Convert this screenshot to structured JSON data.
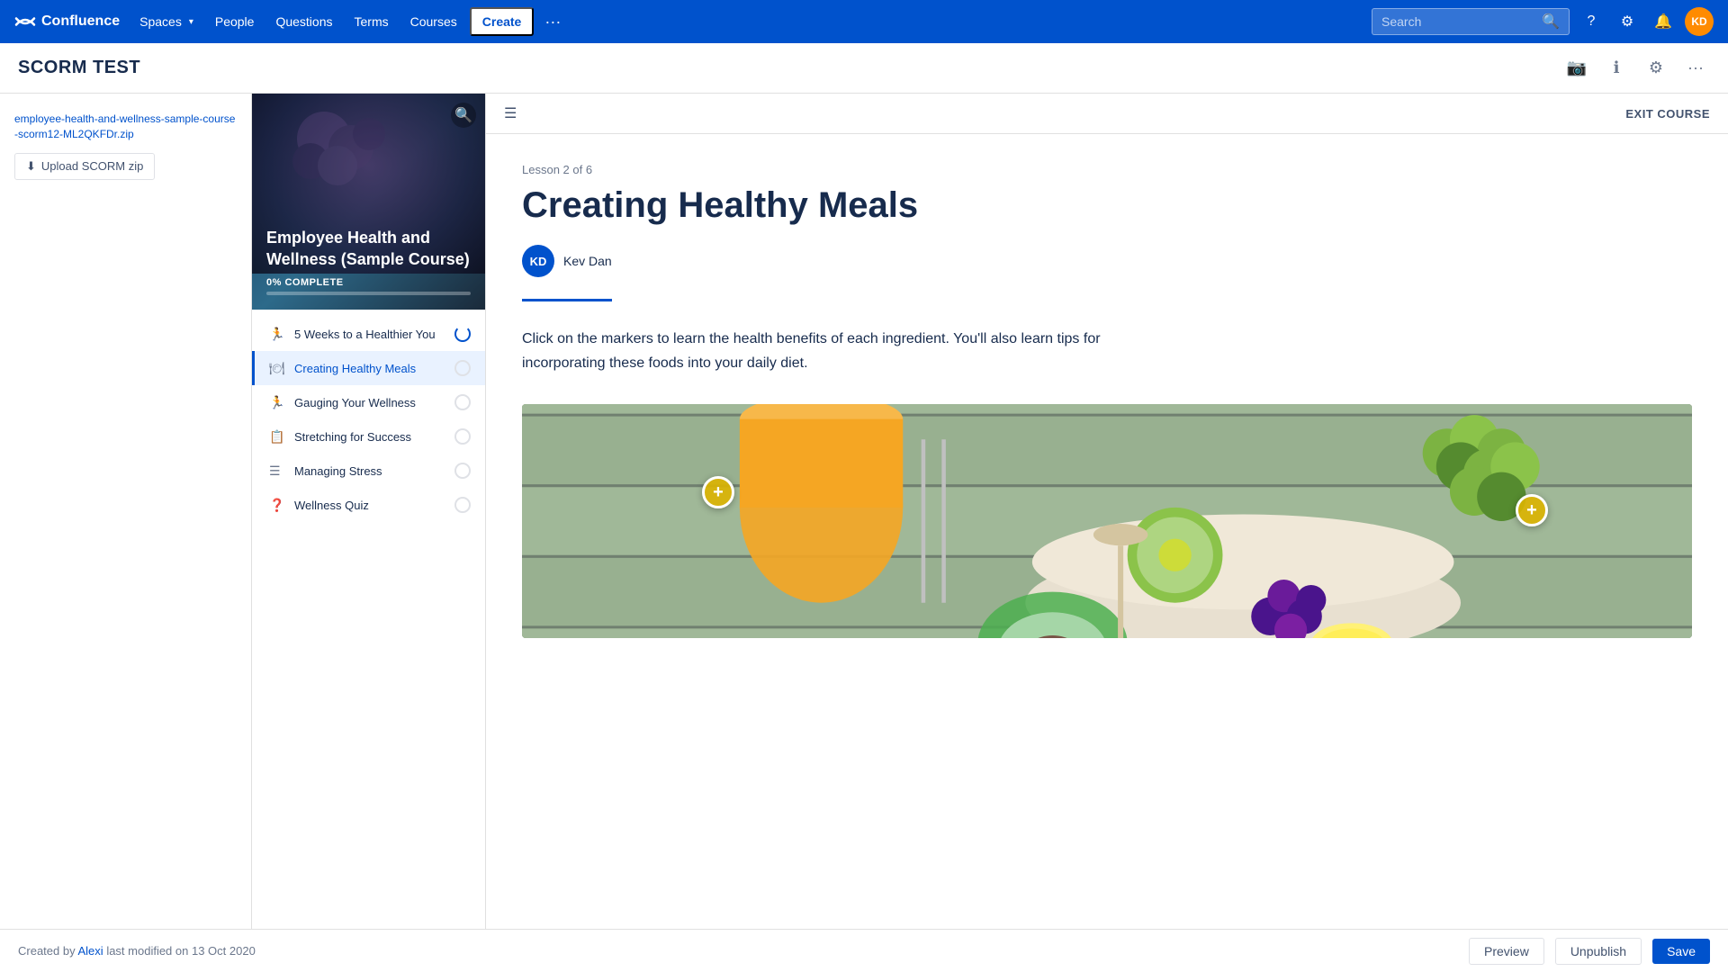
{
  "nav": {
    "logo_text": "Confluence",
    "spaces_label": "Spaces",
    "people_label": "People",
    "questions_label": "Questions",
    "terms_label": "Terms",
    "courses_label": "Courses",
    "create_label": "Create",
    "search_placeholder": "Search",
    "more_icon": "···"
  },
  "page_header": {
    "title": "SCORM TEST"
  },
  "sidebar": {
    "file_name": "employee-health-and-wellness-sample-course-scorm12-ML2QKFDr.zip",
    "upload_label": "Upload SCORM zip"
  },
  "course": {
    "hero_title": "Employee Health and Wellness (Sample Course)",
    "progress_label": "0% COMPLETE",
    "progress_pct": 0
  },
  "course_menu": {
    "items": [
      {
        "id": "item-1",
        "icon": "🏃",
        "label": "5 Weeks to a Healthier You",
        "status": "loading",
        "active": false
      },
      {
        "id": "item-2",
        "icon": "🍽",
        "label": "Creating Healthy Meals",
        "status": "empty",
        "active": true
      },
      {
        "id": "item-3",
        "icon": "🏃",
        "label": "Gauging Your Wellness",
        "status": "empty",
        "active": false
      },
      {
        "id": "item-4",
        "icon": "📋",
        "label": "Stretching for Success",
        "status": "empty",
        "active": false
      },
      {
        "id": "item-5",
        "icon": "☰",
        "label": "Managing Stress",
        "status": "empty",
        "active": false
      },
      {
        "id": "item-6",
        "icon": "❓",
        "label": "Wellness Quiz",
        "status": "empty",
        "active": false
      }
    ]
  },
  "lesson": {
    "label": "Lesson 2 of 6",
    "title": "Creating Healthy Meals",
    "author_initials": "KD",
    "author_name": "Kev Dan",
    "description": "Click on the markers to learn the health benefits of each ingredient. You'll also learn tips for incorporating these foods into your daily diet.",
    "exit_label": "EXIT COURSE"
  },
  "bottom_bar": {
    "created_text": "Created by",
    "author_link": "Alexi",
    "modified_text": "last modified on 13 Oct 2020",
    "preview_label": "Preview",
    "unpublish_label": "Unpublish",
    "save_label": "Save"
  }
}
